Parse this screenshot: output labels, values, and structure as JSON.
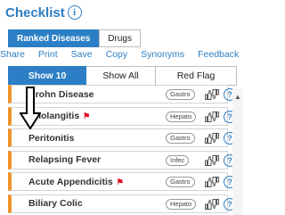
{
  "header": {
    "title": "Checklist",
    "info_icon": "i"
  },
  "top_tabs": [
    {
      "label": "Ranked Diseases",
      "active": true
    },
    {
      "label": "Drugs",
      "active": false
    }
  ],
  "actions": [
    "Share",
    "Print",
    "Save",
    "Copy",
    "Synonyms",
    "Feedback"
  ],
  "filter_tabs": [
    {
      "label": "Show 10",
      "active": true
    },
    {
      "label": "Show All",
      "active": false
    },
    {
      "label": "Red Flag",
      "active": false
    }
  ],
  "diseases": [
    {
      "name": "Crohn Disease",
      "tag": "Gastro",
      "red_flag": false
    },
    {
      "name": "Cholangitis",
      "tag": "Hepato",
      "red_flag": true
    },
    {
      "name": "Peritonitis",
      "tag": "Gastro",
      "red_flag": false
    },
    {
      "name": "Relapsing Fever",
      "tag": "Infec",
      "red_flag": false
    },
    {
      "name": "Acute Appendicitis",
      "tag": "Gastro",
      "red_flag": true
    },
    {
      "name": "Biliary Colic",
      "tag": "Hepato",
      "red_flag": false
    }
  ],
  "help_glyph": "?",
  "colors": {
    "accent": "#2c7fc4",
    "row_marker": "#f0932a",
    "red_flag": "#e0001b"
  },
  "icons": {
    "thumbs": "thumbs-up-down-icon",
    "flag": "red-flag-icon",
    "help": "question-icon",
    "cursor": "down-arrow-cursor-icon"
  }
}
